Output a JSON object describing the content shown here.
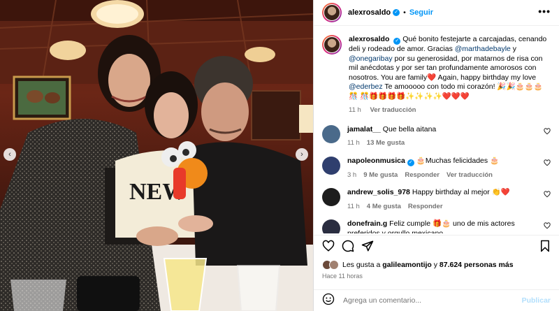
{
  "post": {
    "username": "alexrosaldo",
    "follow_label": "Seguir",
    "more_label": "•••",
    "caption": {
      "username": "alexrosaldo",
      "segments": [
        {
          "text": "Qué bonito festejarte a carcajadas, cenando deli y rodeado de amor. Gracias ",
          "mention": false
        },
        {
          "text": "@marthadebayle",
          "mention": true
        },
        {
          "text": " y ",
          "mention": false
        },
        {
          "text": "@onegaribay",
          "mention": true
        },
        {
          "text": " por su generosidad, por matarnos de risa con mil anécdotas y por ser tan profundamente amorosos con nosotros. You are family❤️ Again, happy birthday my love ",
          "mention": false
        },
        {
          "text": "@ederbez",
          "mention": true
        },
        {
          "text": " Te amooooo con todo mi corazón! 🎉🎉🎂🎂🎂🎊 🎊🎁🎁🎁🎁✨✨✨✨❤️❤️❤️",
          "mention": false
        }
      ],
      "time": "11 h",
      "translate_label": "Ver traducción"
    }
  },
  "photo": {
    "prev_label": "‹",
    "next_label": "›",
    "sweater_text": "NEW"
  },
  "comments": [
    {
      "username": "jamalat__",
      "verified": false,
      "text": "Que bella aitana",
      "time": "11 h",
      "likes": "13 Me gusta",
      "reply": "",
      "translate": "",
      "avatar_color": "#4a6a8a"
    },
    {
      "username": "napoleonmusica",
      "verified": true,
      "text": "🎂Muchas felicidades 🎂",
      "time": "3 h",
      "likes": "9 Me gusta",
      "reply": "Responder",
      "translate": "Ver traducción",
      "avatar_color": "#2f3f6e"
    },
    {
      "username": "andrew_solis_978",
      "verified": false,
      "text": "Happy birthday al mejor 👏❤️",
      "time": "11 h",
      "likes": "4 Me gusta",
      "reply": "Responder",
      "translate": "",
      "avatar_color": "#1d1d1d"
    },
    {
      "username": "donefrain.g",
      "verified": false,
      "text": "Feliz cumple 🎁🎂 uno de mis actores preferidos y orgullo mexicano",
      "time": "",
      "likes": "",
      "reply": "",
      "translate": "",
      "avatar_color": "#2a2d40"
    }
  ],
  "actions": {
    "like_icon": "heart-outline-icon",
    "comment_icon": "comment-icon",
    "share_icon": "paper-plane-icon",
    "save_icon": "bookmark-icon"
  },
  "likes": {
    "prefix": "Les gusta a ",
    "first_user": "galileamontijo",
    "connector": " y ",
    "others": "87.624 personas más"
  },
  "ago": "Hace 11 horas",
  "add_comment": {
    "emoji_icon": "smiley-icon",
    "placeholder": "Agrega un comentario...",
    "publish_label": "Publicar"
  },
  "colors": {
    "accent": "#0095f6",
    "mention": "#00376b",
    "muted": "#737373",
    "publish_disabled": "#b2dffc"
  }
}
